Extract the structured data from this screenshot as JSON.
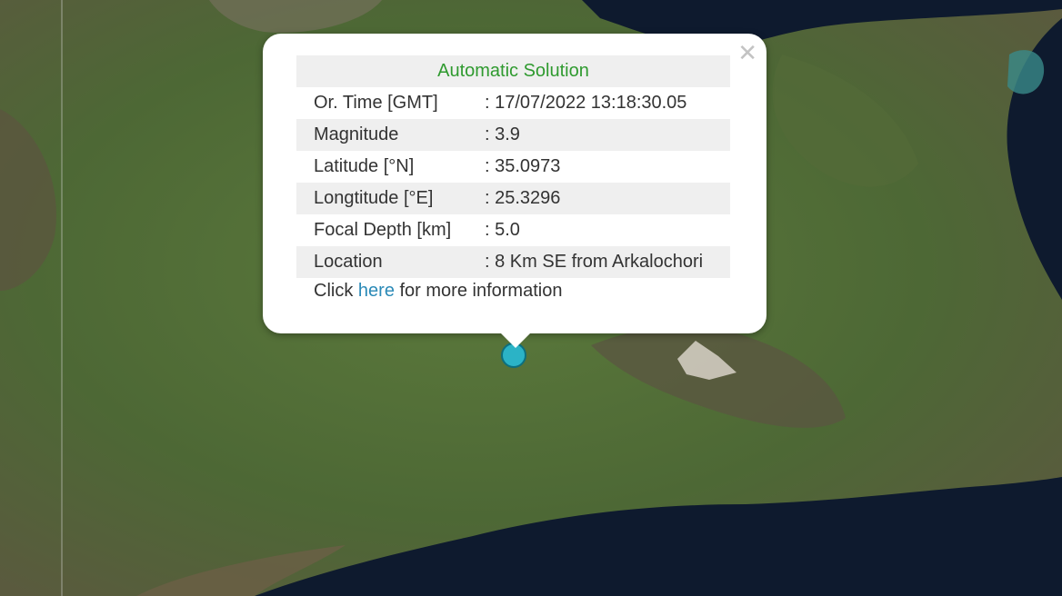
{
  "map": {
    "colors": {
      "land": "#4f6a36",
      "sea": "#0e1a2e",
      "marker": "#2bb3c6"
    }
  },
  "popup": {
    "close_icon": "✕",
    "title": "Automatic Solution",
    "rows": [
      {
        "label": "Or. Time [GMT]",
        "value": ": 17/07/2022 13:18:30.05"
      },
      {
        "label": "Magnitude",
        "value": ": 3.9"
      },
      {
        "label": "Latitude [°N]",
        "value": ": 35.0973"
      },
      {
        "label": "Longtitude [°E]",
        "value": ": 25.3296"
      },
      {
        "label": "Focal Depth [km]",
        "value": ": 5.0"
      },
      {
        "label": "Location",
        "value": ": 8 Km SE from Arkalochori"
      }
    ],
    "more_prefix": "Click",
    "more_link": "here",
    "more_suffix": "for more information"
  }
}
